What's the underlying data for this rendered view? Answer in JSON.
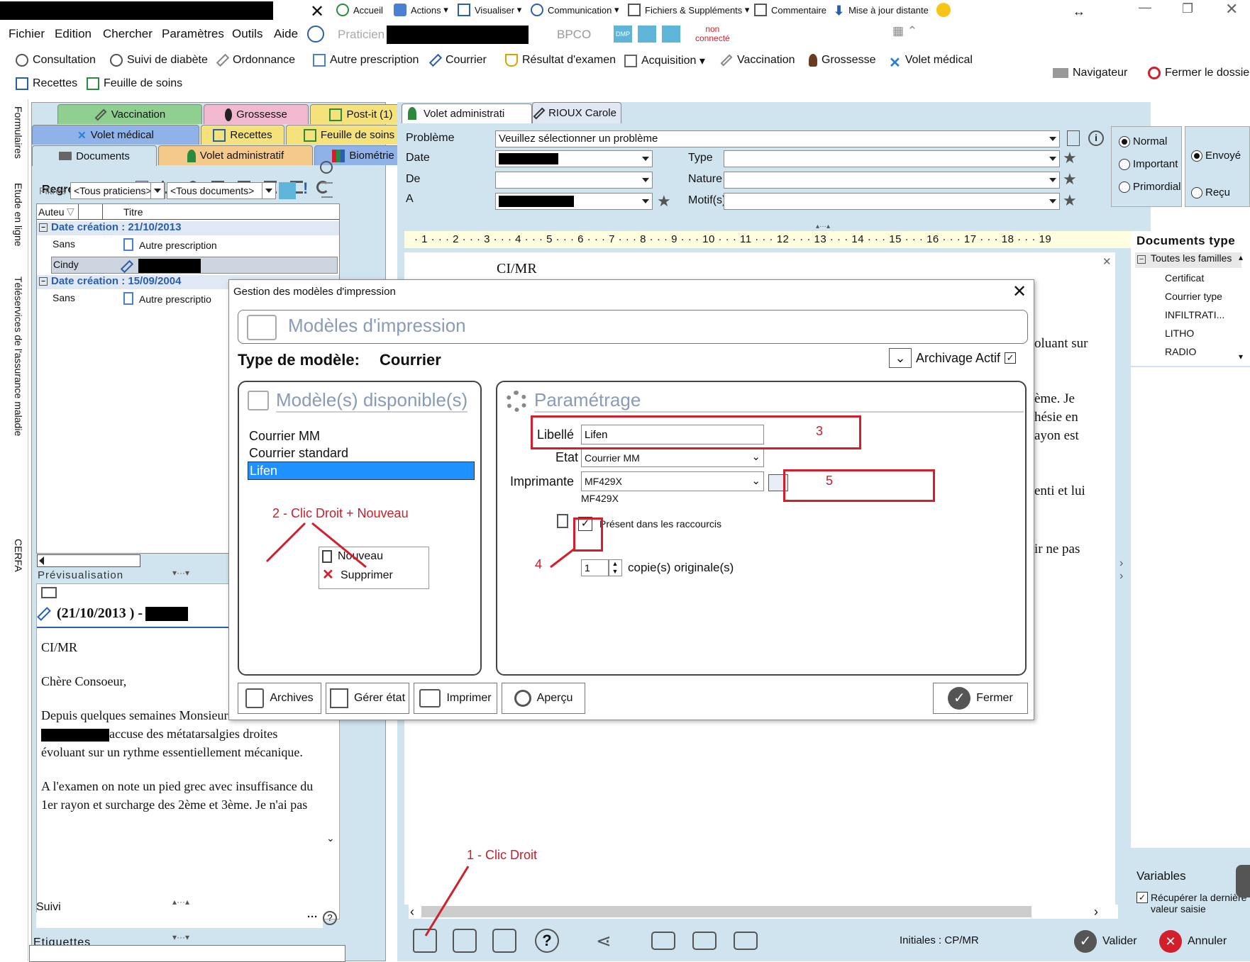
{
  "titlebar": {
    "items": [
      "Accueil",
      "Actions",
      "Visualiser",
      "Communication",
      "Fichiers & Suppléments",
      "Commentaire",
      "Mise à jour distante"
    ]
  },
  "menu": [
    "Fichier",
    "Edition",
    "Chercher",
    "Paramètres",
    "Outils",
    "Aide"
  ],
  "practitioner_label": "Praticien",
  "status": {
    "bpco": "BPCO",
    "dmp": "DMP",
    "connect": "non\nconnecté"
  },
  "toolbar": {
    "row1": [
      "Consultation",
      "Suivi de diabète",
      "Ordonnance",
      "Autre prescription",
      "Courrier",
      "Résultat d'examen",
      "Acquisition",
      "Vaccination",
      "Grossesse",
      "Volet médical"
    ],
    "row2": [
      "Recettes",
      "Feuille de soins"
    ],
    "navigator": "Navigateur",
    "close_file": "Fermer le dossie"
  },
  "side_tabs": [
    "Formulaires",
    "Etude en ligne",
    "Téléservices de l'assurance maladie",
    "CERFA"
  ],
  "left_tabs": {
    "row1": [
      "Vaccination",
      "Grossesse",
      "Post-it (1)"
    ],
    "row2": [
      "Volet médical",
      "Recettes",
      "Feuille de soins"
    ],
    "row3": [
      "Documents",
      "Volet administratif",
      "Biométrie"
    ]
  },
  "grouping_label": "Regroupement :",
  "filters": {
    "label": "Filtres :",
    "praticiens": "<Tous praticiens>",
    "documents": "<Tous documents>"
  },
  "doc_list": {
    "col_author": "Auteu",
    "col_title": "Titre",
    "groups": [
      {
        "date": "Date création : 21/10/2013",
        "rows": [
          {
            "author": "Sans",
            "title": "Autre prescription"
          },
          {
            "author": "Cindy",
            "title": ""
          }
        ]
      },
      {
        "date": "Date création : 15/09/2004",
        "rows": [
          {
            "author": "Sans",
            "title": "Autre prescriptio"
          }
        ]
      }
    ]
  },
  "preview": {
    "label": "Prévisualisation",
    "heading": "(21/10/2013 ) -",
    "lines": [
      "CI/MR",
      "Chère Consoeur,",
      "Depuis quelques semaines Monsieur",
      "accuse des métatarsalgies droites",
      "évoluant sur un rythme essentiellement mécanique.",
      "A l'examen on note un pied grec avec insuffisance du",
      "1er rayon et surcharge des 2ème et 3ème. Je n'ai pas"
    ]
  },
  "suivi_label": "Suivi",
  "etiquettes_label": "Etiquettes",
  "editor": {
    "tabs": [
      "Volet administrati",
      "RIOUX Carole"
    ],
    "fields": {
      "probleme_label": "Problème",
      "probleme_value": "Veuillez sélectionner un problème",
      "date_label": "Date",
      "de_label": "De",
      "a_label": "A",
      "type_label": "Type",
      "nature_label": "Nature",
      "motif_label": "Motif(s)"
    },
    "priority": [
      "Normal",
      "Important",
      "Primordial"
    ],
    "sent": [
      "Envoyé",
      "Reçu"
    ],
    "ruler": "· 1 · · · 2 · · · 3 · · · 4 · · · 5 · · · 6 · · · 7 · · · 8 · · · 9 · · · 10 · · · 11 · · · 12 · · · 13 · · · 14 · · · 15 · · · 16 · · · 17 · · · 18 · · · 19",
    "body_top": "CI/MR",
    "body_right": [
      "oluant sur",
      "ème. Je",
      "hésie en",
      "ayon est",
      "enti et lui",
      "ir ne pas"
    ],
    "initials": "Initiales : CP/MR",
    "validate": "Valider",
    "cancel": "Annuler"
  },
  "doc_types": {
    "title": "Documents type",
    "root": "Toutes les familles",
    "items": [
      "Certificat",
      "Courrier type",
      "INFILTRATI...",
      "LITHO",
      "RADIO"
    ],
    "variables": "Variables",
    "recover": "Récupérer la dernière valeur saisie"
  },
  "dialog": {
    "title": "Gestion des modèles d'impression",
    "header": "Modèles d'impression",
    "model_type_label": "Type de modèle:",
    "model_type_value": "Courrier",
    "archiving": "Archivage Actif",
    "available_title": "Modèle(s) disponible(s)",
    "models": [
      "Courrier MM",
      "Courrier standard",
      "Lifen"
    ],
    "selected_model": "Lifen",
    "context_menu": [
      "Nouveau",
      "Supprimer"
    ],
    "settings_title": "Paramétrage",
    "libelle_label": "Libellé",
    "libelle_value": "Lifen",
    "etat_label": "Etat",
    "etat_value": "Courrier MM",
    "printer_label": "Imprimante",
    "printer_value": "MF429X",
    "printer_sub": "MF429X",
    "shortcut_label": "Présent dans les raccourcis",
    "copies_value": "1",
    "copies_label": "copie(s) originale(s)",
    "buttons": [
      "Archives",
      "Gérer état",
      "Imprimer",
      "Aperçu"
    ],
    "close": "Fermer"
  },
  "annotations": {
    "a1": "1 - Clic Droit",
    "a2": "2 - Clic Droit + Nouveau",
    "a3": "3",
    "a4": "4",
    "a5": "5"
  },
  "colors": {
    "accent_red": "#d21f2b",
    "selection_blue": "#1e90ff",
    "tab_green": "#8fcf8f",
    "tab_pink": "#f2b8d0",
    "tab_yellow": "#f5e27a",
    "tab_blue": "#8fb3e8",
    "tab_orange": "#f5c98a"
  }
}
